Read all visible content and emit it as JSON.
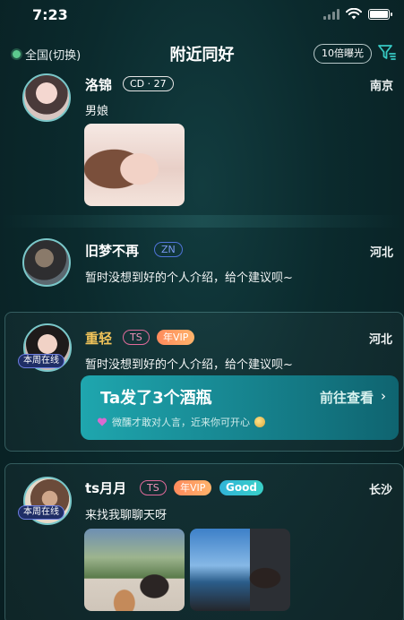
{
  "status_bar": {
    "time": "7:23"
  },
  "header": {
    "location": "全国(切换)",
    "title": "附近同好",
    "exposure_button": "10倍曝光"
  },
  "feed": [
    {
      "name": "洛锦",
      "tags": [
        "CD · 27"
      ],
      "city": "南京",
      "bio": "男娘",
      "online": null
    },
    {
      "name": "旧梦不再",
      "tags": [
        "ZN"
      ],
      "city": "河北",
      "bio": "暂时没想到好的个人介绍，给个建议呗~",
      "online": null
    },
    {
      "name": "重轻",
      "tags": [
        "TS",
        "年VIP"
      ],
      "city": "河北",
      "bio": "暂时没想到好的个人介绍，给个建议呗~",
      "online": "本周在线",
      "banner": {
        "title": "Ta发了3个酒瓶",
        "link": "前往查看",
        "chevron": "›",
        "subtitle": "微醺才敢对人言，近来你可开心"
      }
    },
    {
      "name": "ts月月",
      "tags": [
        "TS",
        "年VIP",
        "Good"
      ],
      "city": "长沙",
      "bio": "来找我聊聊天呀",
      "online": "本周在线"
    }
  ],
  "colors": {
    "accent_teal": "#1fa6ae",
    "vip_name": "#f2c45a",
    "online_badge": "#1f2e66"
  }
}
